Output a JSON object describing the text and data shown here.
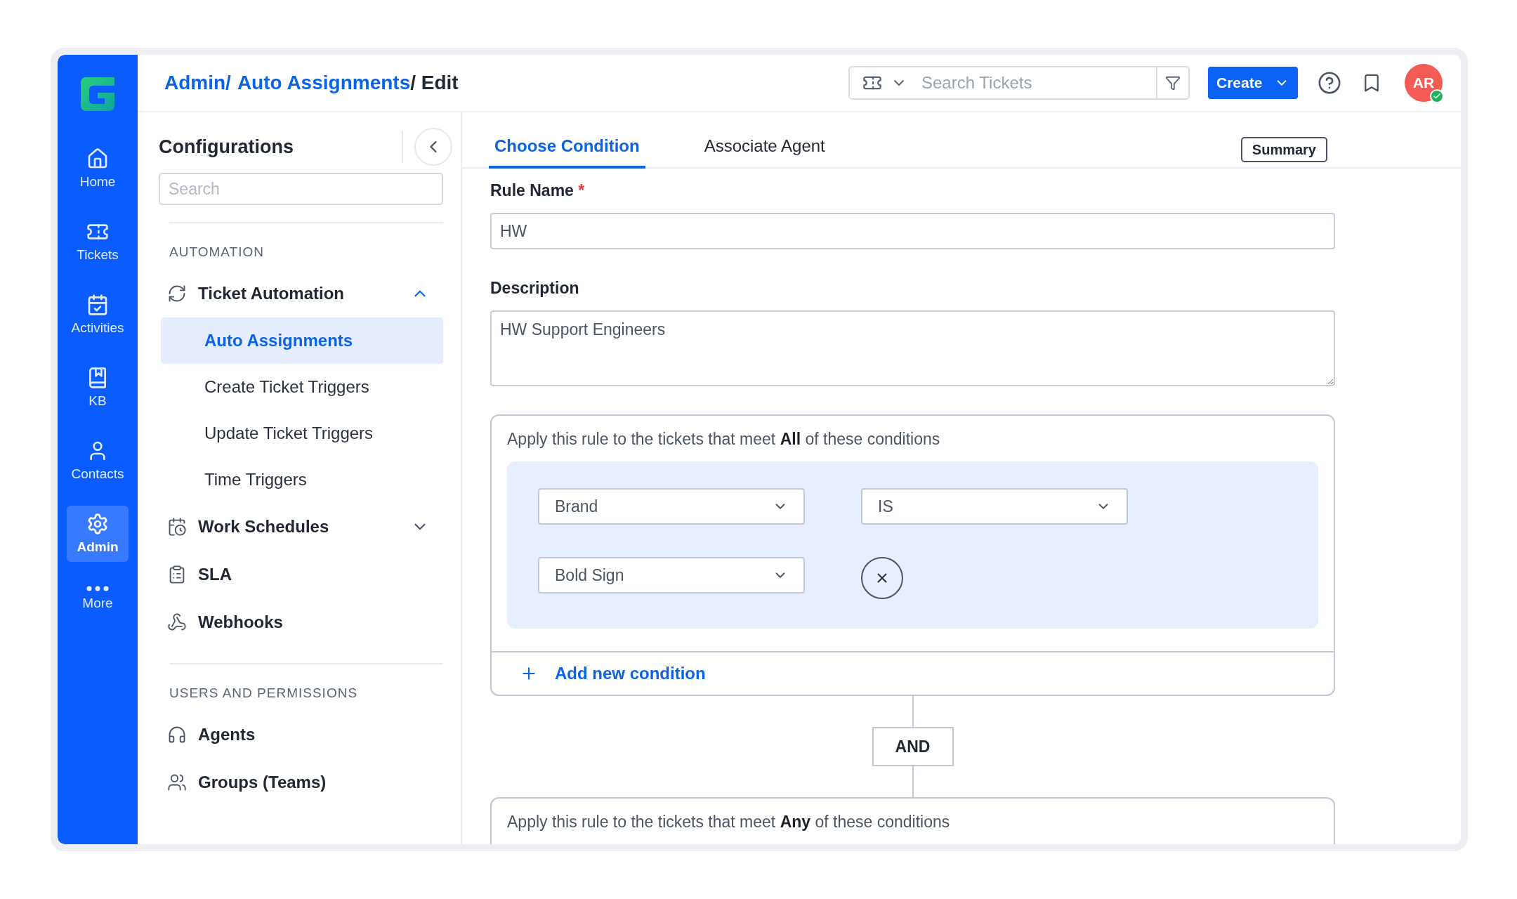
{
  "nav": {
    "items": [
      {
        "label": "Home",
        "selected": false
      },
      {
        "label": "Tickets",
        "selected": false
      },
      {
        "label": "Activities",
        "selected": false
      },
      {
        "label": "KB",
        "selected": false
      },
      {
        "label": "Contacts",
        "selected": false
      },
      {
        "label": "Admin",
        "selected": true
      },
      {
        "label": "More",
        "selected": false
      }
    ]
  },
  "header": {
    "breadcrumb": [
      {
        "label": "Admin/",
        "link": true
      },
      {
        "label": "Auto Assignments",
        "link": true
      },
      {
        "label": "/ Edit",
        "link": false
      }
    ],
    "search": {
      "placeholder": "Search Tickets"
    },
    "create_button": "Create",
    "avatar": {
      "initials": "AR",
      "online": true
    }
  },
  "config": {
    "title": "Configurations",
    "search": {
      "placeholder": "Search"
    },
    "sections": [
      {
        "heading": "AUTOMATION",
        "items": [
          {
            "label": "Ticket Automation",
            "expanded": true,
            "children": [
              {
                "label": "Auto Assignments",
                "selected": true
              },
              {
                "label": "Create Ticket Triggers",
                "selected": false
              },
              {
                "label": "Update Ticket Triggers",
                "selected": false
              },
              {
                "label": "Time Triggers",
                "selected": false
              }
            ]
          },
          {
            "label": "Work Schedules",
            "expanded": false
          },
          {
            "label": "SLA"
          },
          {
            "label": "Webhooks"
          }
        ]
      },
      {
        "heading": "USERS AND PERMISSIONS",
        "items": [
          {
            "label": "Agents"
          },
          {
            "label": "Groups (Teams)"
          }
        ]
      }
    ]
  },
  "tabs": [
    {
      "label": "Choose Condition",
      "selected": true
    },
    {
      "label": "Associate Agent",
      "selected": false
    }
  ],
  "summary_button": "Summary",
  "form": {
    "rule_name": {
      "label": "Rule Name",
      "required": true,
      "required_mark": "*",
      "value": "HW"
    },
    "description": {
      "label": "Description",
      "value": "HW Support Engineers"
    }
  },
  "condition_groups": [
    {
      "intro": "Apply this rule to the tickets that meet **All** of these conditions",
      "conditions": [
        {
          "field": "Brand",
          "operator": "IS",
          "value": "Bold Sign"
        }
      ],
      "add_label": "Add new condition"
    },
    {
      "intro": "Apply this rule to the tickets that meet **Any** of these conditions"
    }
  ],
  "connector": "AND"
}
